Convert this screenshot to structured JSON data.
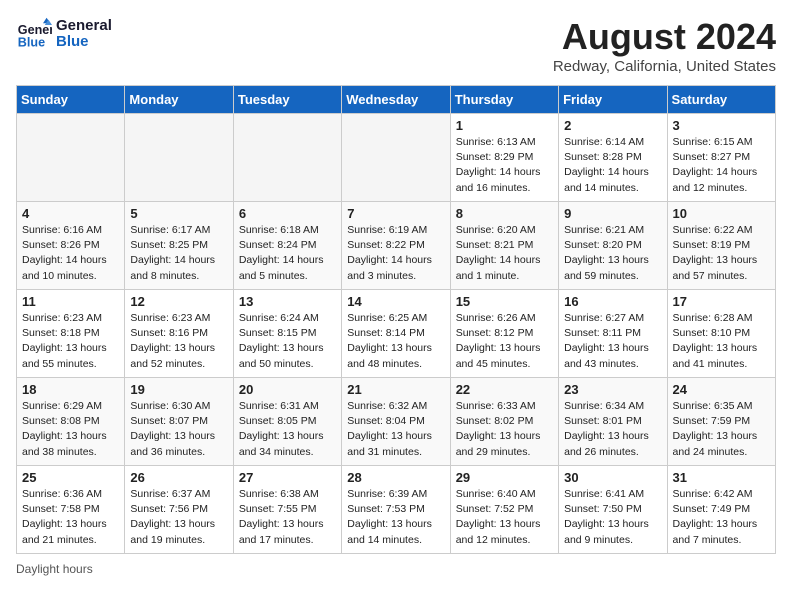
{
  "logo": {
    "line1": "General",
    "line2": "Blue"
  },
  "title": "August 2024",
  "location": "Redway, California, United States",
  "days_of_week": [
    "Sunday",
    "Monday",
    "Tuesday",
    "Wednesday",
    "Thursday",
    "Friday",
    "Saturday"
  ],
  "weeks": [
    [
      {
        "day": "",
        "info": ""
      },
      {
        "day": "",
        "info": ""
      },
      {
        "day": "",
        "info": ""
      },
      {
        "day": "",
        "info": ""
      },
      {
        "day": "1",
        "info": "Sunrise: 6:13 AM\nSunset: 8:29 PM\nDaylight: 14 hours\nand 16 minutes."
      },
      {
        "day": "2",
        "info": "Sunrise: 6:14 AM\nSunset: 8:28 PM\nDaylight: 14 hours\nand 14 minutes."
      },
      {
        "day": "3",
        "info": "Sunrise: 6:15 AM\nSunset: 8:27 PM\nDaylight: 14 hours\nand 12 minutes."
      }
    ],
    [
      {
        "day": "4",
        "info": "Sunrise: 6:16 AM\nSunset: 8:26 PM\nDaylight: 14 hours\nand 10 minutes."
      },
      {
        "day": "5",
        "info": "Sunrise: 6:17 AM\nSunset: 8:25 PM\nDaylight: 14 hours\nand 8 minutes."
      },
      {
        "day": "6",
        "info": "Sunrise: 6:18 AM\nSunset: 8:24 PM\nDaylight: 14 hours\nand 5 minutes."
      },
      {
        "day": "7",
        "info": "Sunrise: 6:19 AM\nSunset: 8:22 PM\nDaylight: 14 hours\nand 3 minutes."
      },
      {
        "day": "8",
        "info": "Sunrise: 6:20 AM\nSunset: 8:21 PM\nDaylight: 14 hours\nand 1 minute."
      },
      {
        "day": "9",
        "info": "Sunrise: 6:21 AM\nSunset: 8:20 PM\nDaylight: 13 hours\nand 59 minutes."
      },
      {
        "day": "10",
        "info": "Sunrise: 6:22 AM\nSunset: 8:19 PM\nDaylight: 13 hours\nand 57 minutes."
      }
    ],
    [
      {
        "day": "11",
        "info": "Sunrise: 6:23 AM\nSunset: 8:18 PM\nDaylight: 13 hours\nand 55 minutes."
      },
      {
        "day": "12",
        "info": "Sunrise: 6:23 AM\nSunset: 8:16 PM\nDaylight: 13 hours\nand 52 minutes."
      },
      {
        "day": "13",
        "info": "Sunrise: 6:24 AM\nSunset: 8:15 PM\nDaylight: 13 hours\nand 50 minutes."
      },
      {
        "day": "14",
        "info": "Sunrise: 6:25 AM\nSunset: 8:14 PM\nDaylight: 13 hours\nand 48 minutes."
      },
      {
        "day": "15",
        "info": "Sunrise: 6:26 AM\nSunset: 8:12 PM\nDaylight: 13 hours\nand 45 minutes."
      },
      {
        "day": "16",
        "info": "Sunrise: 6:27 AM\nSunset: 8:11 PM\nDaylight: 13 hours\nand 43 minutes."
      },
      {
        "day": "17",
        "info": "Sunrise: 6:28 AM\nSunset: 8:10 PM\nDaylight: 13 hours\nand 41 minutes."
      }
    ],
    [
      {
        "day": "18",
        "info": "Sunrise: 6:29 AM\nSunset: 8:08 PM\nDaylight: 13 hours\nand 38 minutes."
      },
      {
        "day": "19",
        "info": "Sunrise: 6:30 AM\nSunset: 8:07 PM\nDaylight: 13 hours\nand 36 minutes."
      },
      {
        "day": "20",
        "info": "Sunrise: 6:31 AM\nSunset: 8:05 PM\nDaylight: 13 hours\nand 34 minutes."
      },
      {
        "day": "21",
        "info": "Sunrise: 6:32 AM\nSunset: 8:04 PM\nDaylight: 13 hours\nand 31 minutes."
      },
      {
        "day": "22",
        "info": "Sunrise: 6:33 AM\nSunset: 8:02 PM\nDaylight: 13 hours\nand 29 minutes."
      },
      {
        "day": "23",
        "info": "Sunrise: 6:34 AM\nSunset: 8:01 PM\nDaylight: 13 hours\nand 26 minutes."
      },
      {
        "day": "24",
        "info": "Sunrise: 6:35 AM\nSunset: 7:59 PM\nDaylight: 13 hours\nand 24 minutes."
      }
    ],
    [
      {
        "day": "25",
        "info": "Sunrise: 6:36 AM\nSunset: 7:58 PM\nDaylight: 13 hours\nand 21 minutes."
      },
      {
        "day": "26",
        "info": "Sunrise: 6:37 AM\nSunset: 7:56 PM\nDaylight: 13 hours\nand 19 minutes."
      },
      {
        "day": "27",
        "info": "Sunrise: 6:38 AM\nSunset: 7:55 PM\nDaylight: 13 hours\nand 17 minutes."
      },
      {
        "day": "28",
        "info": "Sunrise: 6:39 AM\nSunset: 7:53 PM\nDaylight: 13 hours\nand 14 minutes."
      },
      {
        "day": "29",
        "info": "Sunrise: 6:40 AM\nSunset: 7:52 PM\nDaylight: 13 hours\nand 12 minutes."
      },
      {
        "day": "30",
        "info": "Sunrise: 6:41 AM\nSunset: 7:50 PM\nDaylight: 13 hours\nand 9 minutes."
      },
      {
        "day": "31",
        "info": "Sunrise: 6:42 AM\nSunset: 7:49 PM\nDaylight: 13 hours\nand 7 minutes."
      }
    ]
  ],
  "footer": "Daylight hours"
}
